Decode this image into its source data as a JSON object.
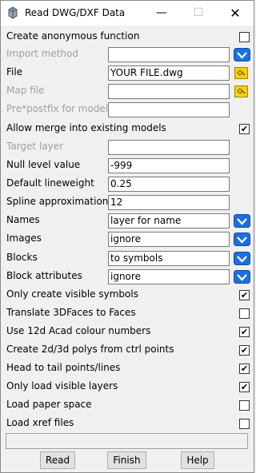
{
  "window": {
    "title": "Read DWG/DXF Data"
  },
  "rows": [
    {
      "label": "Create anonymous function",
      "checked": false
    },
    {
      "label": "Import method",
      "value": ""
    },
    {
      "label": "File",
      "value": "YOUR FILE.dwg"
    },
    {
      "label": "Map file",
      "value": ""
    },
    {
      "label": "Pre*postfix for models",
      "value": ""
    },
    {
      "label": "Allow merge into existing models",
      "checked": true
    },
    {
      "label": "Target layer",
      "value": ""
    },
    {
      "label": "Null level value",
      "value": "-999"
    },
    {
      "label": "Default lineweight",
      "value": "0.25"
    },
    {
      "label": "Spline approximation",
      "value": "12"
    },
    {
      "label": "Names",
      "value": "layer for name"
    },
    {
      "label": "Images",
      "value": "ignore"
    },
    {
      "label": "Blocks",
      "value": "to symbols"
    },
    {
      "label": "Block attributes",
      "value": "ignore"
    },
    {
      "label": "Only create visible symbols",
      "checked": true
    },
    {
      "label": "Translate 3DFaces to Faces",
      "checked": false
    },
    {
      "label": "Use 12d Acad colour numbers",
      "checked": true
    },
    {
      "label": "Create 2d/3d polys from ctrl points",
      "checked": true
    },
    {
      "label": "Head to tail points/lines",
      "checked": true
    },
    {
      "label": "Only load visible layers",
      "checked": true
    },
    {
      "label": "Load paper space",
      "checked": false
    },
    {
      "label": "Load xref files",
      "checked": false
    }
  ],
  "buttons": {
    "read": "Read",
    "finish": "Finish",
    "help": "Help"
  },
  "colors": {
    "dropdown_accent": "#1e6fd9",
    "pick_accent": "#f5d200"
  }
}
